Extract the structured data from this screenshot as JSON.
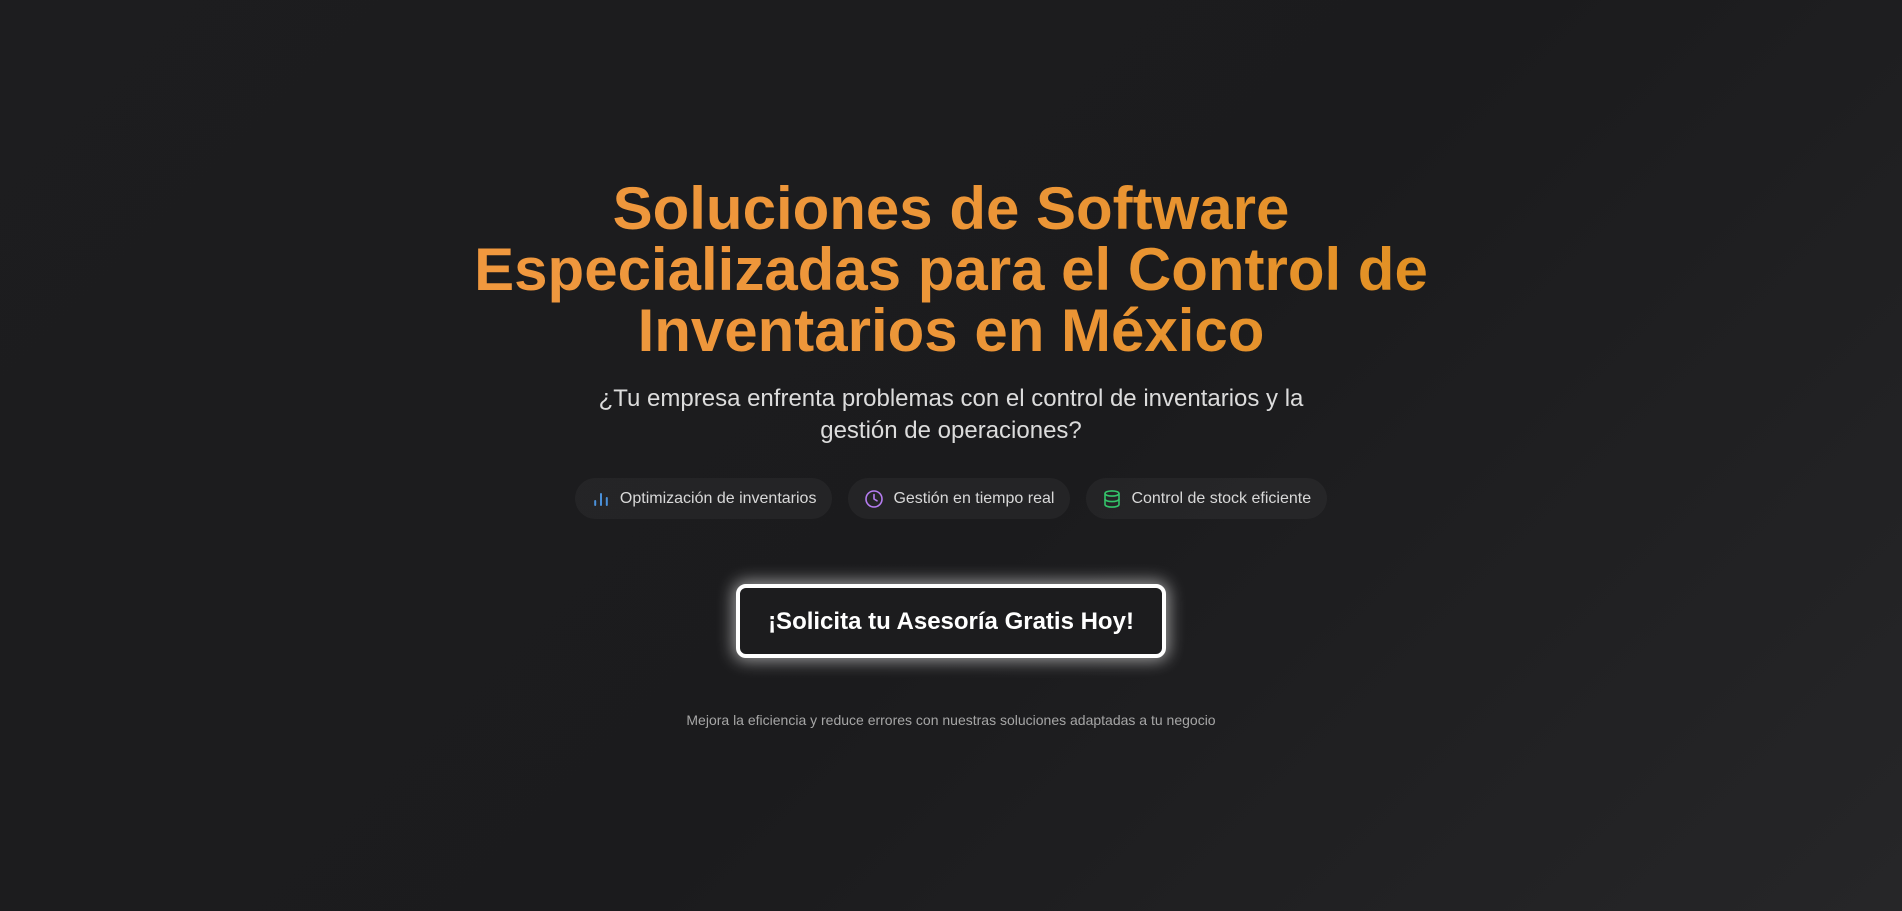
{
  "hero": {
    "title_lines": [
      "Soluciones de Software",
      "Especializadas para el Control de",
      "Inventarios en México"
    ],
    "subtitle_lines": [
      "¿Tu empresa enfrenta problemas con el control de inventarios y la",
      "gestión de operaciones?"
    ],
    "features": [
      {
        "label": "Optimización de inventarios",
        "icon": "bar-chart-icon",
        "color": "#4a90d9"
      },
      {
        "label": "Gestión en tiempo real",
        "icon": "clock-icon",
        "color": "#b57cf0"
      },
      {
        "label": "Control de stock eficiente",
        "icon": "database-icon",
        "color": "#34c46a"
      }
    ],
    "cta_label": "¡Solicita tu Asesoría Gratis Hoy!",
    "footnote": "Mejora la eficiencia y reduce errores con nuestras soluciones adaptadas a tu negocio"
  },
  "colors": {
    "accent_orange": "#f49a46",
    "accent_gold": "#d68a0c",
    "background": "#1c1c1e"
  }
}
